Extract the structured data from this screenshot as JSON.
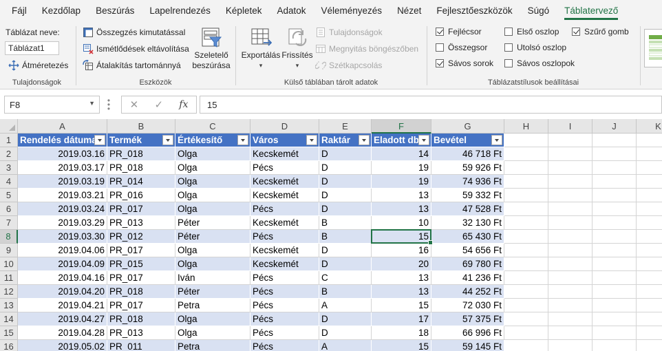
{
  "ribbon_tabs": [
    "Fájl",
    "Kezdőlap",
    "Beszúrás",
    "Lapelrendezés",
    "Képletek",
    "Adatok",
    "Véleményezés",
    "Nézet",
    "Fejlesztőeszközök",
    "Súgó",
    "Táblatervező"
  ],
  "active_tab": "Táblatervező",
  "properties_group": {
    "name_label": "Táblázat neve:",
    "name_value": "Táblázat1",
    "resize_label": "Átméretezés",
    "group_label": "Tulajdonságok"
  },
  "tools_group": {
    "summarize_pivot": "Összegzés kimutatással",
    "remove_duplicates": "Ismétlődések eltávolítása",
    "convert_to_range": "Átalakítás tartománnyá",
    "slicer_line1": "Szeletelő",
    "slicer_line2": "beszúrása",
    "group_label": "Eszközök"
  },
  "external_group": {
    "export": "Exportálás",
    "refresh": "Frissítés",
    "properties": "Tulajdonságok",
    "open_in_browser": "Megnyitás böngészőben",
    "unlink": "Szétkapcsolás",
    "group_label": "Külső táblában tárolt adatok"
  },
  "style_options_group": {
    "header_row": {
      "label": "Fejlécsor",
      "checked": true
    },
    "total_row": {
      "label": "Összegsor",
      "checked": false
    },
    "banded_rows": {
      "label": "Sávos sorok",
      "checked": true
    },
    "first_column": {
      "label": "Első oszlop",
      "checked": false
    },
    "last_column": {
      "label": "Utolsó oszlop",
      "checked": false
    },
    "banded_columns": {
      "label": "Sávos oszlopok",
      "checked": false
    },
    "filter_button": {
      "label": "Szűrő gomb",
      "checked": true
    },
    "group_label": "Táblázatstílusok beállításai"
  },
  "formula_bar": {
    "name_box": "F8",
    "fx_label": "fx",
    "formula": "15"
  },
  "columns": [
    "A",
    "B",
    "C",
    "D",
    "E",
    "F",
    "G",
    "H",
    "I",
    "J",
    "K"
  ],
  "selected_column": "F",
  "selected_row": 8,
  "table": {
    "headers": [
      "Rendelés dátuma",
      "Termék",
      "Értékesítő",
      "Város",
      "Raktár",
      "Eladott db",
      "Bevétel"
    ],
    "rows": [
      [
        "2019.03.16",
        "PR_018",
        "Olga",
        "Kecskemét",
        "D",
        "14",
        "46 718 Ft"
      ],
      [
        "2019.03.17",
        "PR_018",
        "Olga",
        "Pécs",
        "D",
        "19",
        "59 926 Ft"
      ],
      [
        "2019.03.19",
        "PR_014",
        "Olga",
        "Kecskemét",
        "D",
        "19",
        "74 936 Ft"
      ],
      [
        "2019.03.21",
        "PR_016",
        "Olga",
        "Kecskemét",
        "D",
        "13",
        "59 332 Ft"
      ],
      [
        "2019.03.24",
        "PR_017",
        "Olga",
        "Pécs",
        "D",
        "13",
        "47 528 Ft"
      ],
      [
        "2019.03.29",
        "PR_013",
        "Péter",
        "Kecskemét",
        "B",
        "10",
        "32 130 Ft"
      ],
      [
        "2019.03.30",
        "PR_012",
        "Péter",
        "Pécs",
        "B",
        "15",
        "65 430 Ft"
      ],
      [
        "2019.04.06",
        "PR_017",
        "Olga",
        "Kecskemét",
        "D",
        "16",
        "54 656 Ft"
      ],
      [
        "2019.04.09",
        "PR_015",
        "Olga",
        "Kecskemét",
        "D",
        "20",
        "69 780 Ft"
      ],
      [
        "2019.04.16",
        "PR_017",
        "Iván",
        "Pécs",
        "C",
        "13",
        "41 236 Ft"
      ],
      [
        "2019.04.20",
        "PR_018",
        "Péter",
        "Pécs",
        "B",
        "13",
        "44 252 Ft"
      ],
      [
        "2019.04.21",
        "PR_017",
        "Petra",
        "Pécs",
        "A",
        "15",
        "72 030 Ft"
      ],
      [
        "2019.04.27",
        "PR_018",
        "Olga",
        "Pécs",
        "D",
        "17",
        "57 375 Ft"
      ],
      [
        "2019.04.28",
        "PR_013",
        "Olga",
        "Pécs",
        "D",
        "18",
        "66 996 Ft"
      ],
      [
        "2019.05.02",
        "PR_011",
        "Petra",
        "Pécs",
        "A",
        "15",
        "59 145 Ft"
      ]
    ]
  },
  "colors": {
    "accent": "#217346",
    "table_header": "#4472c4",
    "band": "#d9e1f2"
  }
}
